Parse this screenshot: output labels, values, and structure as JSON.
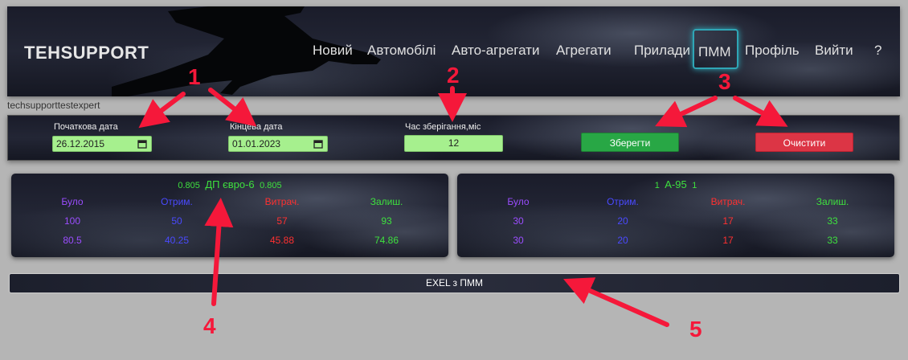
{
  "header": {
    "brand": "TEHSUPPORT",
    "nav": [
      {
        "label": "Новий"
      },
      {
        "label": "Автомобілі"
      },
      {
        "label": "Авто-агрегати"
      },
      {
        "label": "Агрегати"
      },
      {
        "label": "Прилади"
      },
      {
        "label": "ПММ"
      },
      {
        "label": "Профіль"
      },
      {
        "label": "Вийти"
      },
      {
        "label": "?"
      }
    ],
    "active_nav": "ПММ"
  },
  "username": "techsupporttestexpert",
  "filters": {
    "start_date_label": "Початкова дата",
    "start_date_value": "26.12.2015",
    "end_date_label": "Кінцева дата",
    "end_date_value": "01.01.2023",
    "storage_label": "Час зберігання,міс",
    "storage_value": "12",
    "save_label": "Зберегти",
    "clear_label": "Очистити"
  },
  "cards": [
    {
      "qty_left": "0.805",
      "name": "ДП євро-6",
      "qty_right": "0.805",
      "headers": [
        "Було",
        "Отрим.",
        "Витрач.",
        "Залиш."
      ],
      "rows": [
        [
          "100",
          "50",
          "57",
          "93"
        ],
        [
          "80.5",
          "40.25",
          "45.88",
          "74.86"
        ]
      ]
    },
    {
      "qty_left": "1",
      "name": "А-95",
      "qty_right": "1",
      "headers": [
        "Було",
        "Отрим.",
        "Витрач.",
        "Залиш."
      ],
      "rows": [
        [
          "30",
          "20",
          "17",
          "33"
        ],
        [
          "30",
          "20",
          "17",
          "33"
        ]
      ]
    }
  ],
  "excel_label": "EXEL з ПММ",
  "annotations": [
    "1",
    "2",
    "3",
    "4",
    "5"
  ],
  "colors": {
    "annotation": "#f5183a",
    "input_bg": "#a6f08e",
    "save": "#28a745",
    "clear": "#dc3545",
    "active_border": "#2fa6b6"
  }
}
